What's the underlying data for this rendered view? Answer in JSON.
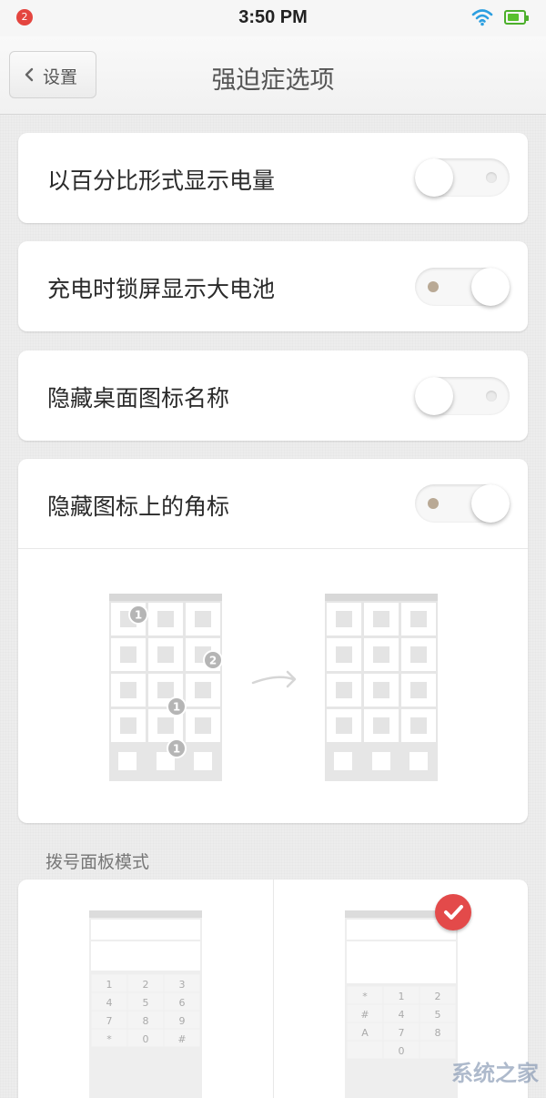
{
  "status_bar": {
    "notification_count": "2",
    "time": "3:50 PM",
    "icons": [
      "wifi-icon",
      "battery-icon"
    ],
    "battery_level": 0.75,
    "battery_color": "#4caf2b"
  },
  "nav": {
    "back_label": "设置",
    "title": "强迫症选项"
  },
  "settings": [
    {
      "label": "以百分比形式显示电量",
      "enabled": false
    },
    {
      "label": "充电时锁屏显示大电池",
      "enabled": true
    },
    {
      "label": "隐藏桌面图标名称",
      "enabled": false
    },
    {
      "label": "隐藏图标上的角标",
      "enabled": true
    }
  ],
  "badge_demo": {
    "badges": [
      "1",
      "2",
      "1",
      "1"
    ],
    "arrow_icon": "arrow-right-icon"
  },
  "dialpad_section": {
    "label": "拨号面板模式",
    "options": [
      {
        "name": "dialpad-layout-standard",
        "keys": [
          "1",
          "2",
          "3",
          "4",
          "5",
          "6",
          "7",
          "8",
          "9",
          "*",
          "0",
          "#"
        ],
        "selected": false
      },
      {
        "name": "dialpad-layout-alternate",
        "keys": [
          "*",
          "1",
          "2",
          "#",
          "4",
          "5",
          "A",
          "7",
          "8",
          "",
          "0",
          ""
        ],
        "selected": true
      }
    ],
    "selected_icon": "checkmark-icon",
    "accent": "#e34a4a"
  },
  "watermark": "系统之家"
}
